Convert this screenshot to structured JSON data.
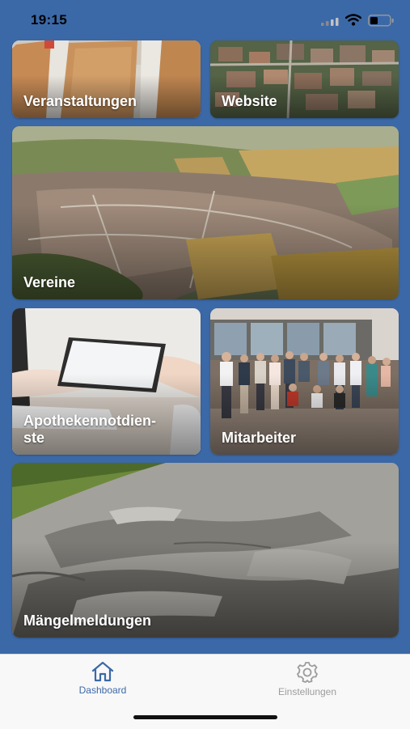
{
  "status_bar": {
    "time": "19:15"
  },
  "tiles": [
    {
      "id": "events",
      "label": "Veranstaltungen"
    },
    {
      "id": "website",
      "label": "Website"
    },
    {
      "id": "clubs",
      "label": "Vereine"
    },
    {
      "id": "pharmacy",
      "label": "Apothekennotdienste"
    },
    {
      "id": "staff",
      "label": "Mitarbeiter"
    },
    {
      "id": "defects",
      "label": "Mängelmeldungen"
    }
  ],
  "tab_bar": {
    "items": [
      {
        "label": "Dashboard",
        "icon": "home-icon",
        "active": true,
        "color": "#3b69a8"
      },
      {
        "label": "Einstellungen",
        "icon": "gear-icon",
        "active": false,
        "color": "#9c9c9c"
      }
    ]
  },
  "colors": {
    "accent": "#3b69a8",
    "tab_bar_bg": "#f8f8f8"
  }
}
